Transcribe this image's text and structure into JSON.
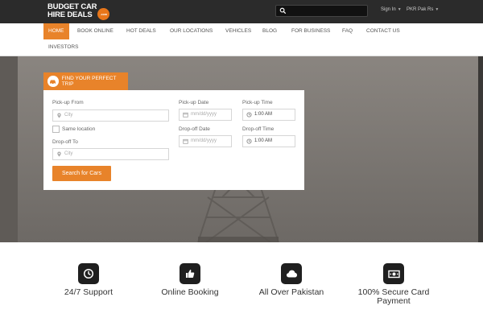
{
  "header": {
    "logo_line1": "BUDGET CAR",
    "logo_line2": "HIRE DEALS",
    "logo_badge": ".com",
    "signin_label": "Sign In",
    "currency_label": "PKR Pak Rs"
  },
  "nav": {
    "items": [
      "Home",
      "Book Online",
      "Hot Deals",
      "Our Locations",
      "Vehicles",
      "Blog",
      "For Business",
      "FAQ",
      "Contact Us",
      "Investors"
    ]
  },
  "trip": {
    "tab_label": "Find Your Perfect Trip",
    "pickup_from_label": "Pick-up From",
    "pickup_from_placeholder": "City",
    "same_location_label": "Same location",
    "dropoff_to_label": "Drop-off To",
    "dropoff_to_placeholder": "City",
    "pickup_date_label": "Pick-up Date",
    "pickup_date_placeholder": "mm/dd/yyyy",
    "dropoff_date_label": "Drop-off Date",
    "dropoff_date_placeholder": "mm/dd/yyyy",
    "pickup_time_label": "Pick-up Time",
    "pickup_time_value": "1:00 AM",
    "dropoff_time_label": "Drop-off Time",
    "dropoff_time_value": "1:00 AM",
    "search_button": "Search for Cars"
  },
  "features": [
    {
      "icon": "clock-icon",
      "label": "24/7 Support"
    },
    {
      "icon": "thumbs-up-icon",
      "label": "Online Booking"
    },
    {
      "icon": "cloud-icon",
      "label": "All Over Pakistan"
    },
    {
      "icon": "cash-icon",
      "label": "100% Secure Card Payment"
    }
  ],
  "colors": {
    "accent": "#e8832a",
    "topbar": "#2b2b2b"
  }
}
